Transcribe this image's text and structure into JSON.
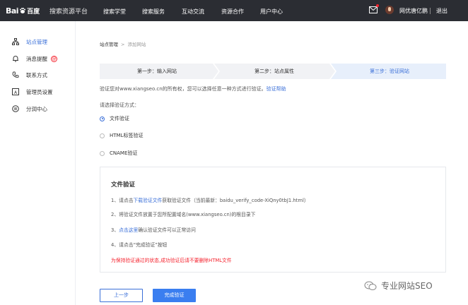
{
  "header": {
    "logo_text_bai": "Bai",
    "logo_text_du": "百度",
    "platform_title": "搜索资源平台",
    "nav": [
      "搜索学堂",
      "搜索服务",
      "互动交流",
      "资源合作",
      "用户中心"
    ],
    "username": "网优唐亿鹏",
    "logout": "退出",
    "colors": {
      "bar": "#2b2d33",
      "accent": "#3a6fd8"
    }
  },
  "sidebar": {
    "items": [
      {
        "label": "站点管理",
        "icon": "sitemap-icon",
        "active": true
      },
      {
        "label": "消息提醒",
        "icon": "bell-icon",
        "badge": "@"
      },
      {
        "label": "联系方式",
        "icon": "phone-icon"
      },
      {
        "label": "管理员设置",
        "icon": "admin-icon"
      },
      {
        "label": "分润中心",
        "icon": "coin-icon"
      }
    ]
  },
  "breadcrumb": {
    "root": "站点管理",
    "separator": ">",
    "current": "添加网站"
  },
  "steps": [
    {
      "label": "第一步：输入网站"
    },
    {
      "label": "第二步：站点属性"
    },
    {
      "label": "第三步：验证网站",
      "active": true
    }
  ],
  "verify": {
    "desc": "验证您对www.xiangseo.cn的所有权，您可以选择任意一种方式进行验证。",
    "help_link": "验证帮助",
    "choose_label": "请选择验证方式：",
    "methods": [
      {
        "label": "文件验证",
        "checked": true
      },
      {
        "label": "HTML标签验证",
        "checked": false
      },
      {
        "label": "CNAME验证",
        "checked": false
      }
    ]
  },
  "panel": {
    "title": "文件验证",
    "step1_prefix": "1、请点击",
    "step1_link": "下载验证文件",
    "step1_suffix": "获取验证文件（当前最新：baidu_verify_code-XiQny0tbJ1.html）",
    "step2": "2、将验证文件放置于您所配置域名(www.xiangseo.cn)的根目录下",
    "step3_prefix": "3、",
    "step3_link": "点击这里",
    "step3_suffix": "确认验证文件可以正常访问",
    "step4": "4、请点击“完成验证”按钮",
    "warning": "为保持验证通过的状态,成功验证后请不要删除HTML文件"
  },
  "buttons": {
    "prev": "上一步",
    "done": "完成验证"
  },
  "watermark": {
    "text": "专业网站SEO"
  }
}
